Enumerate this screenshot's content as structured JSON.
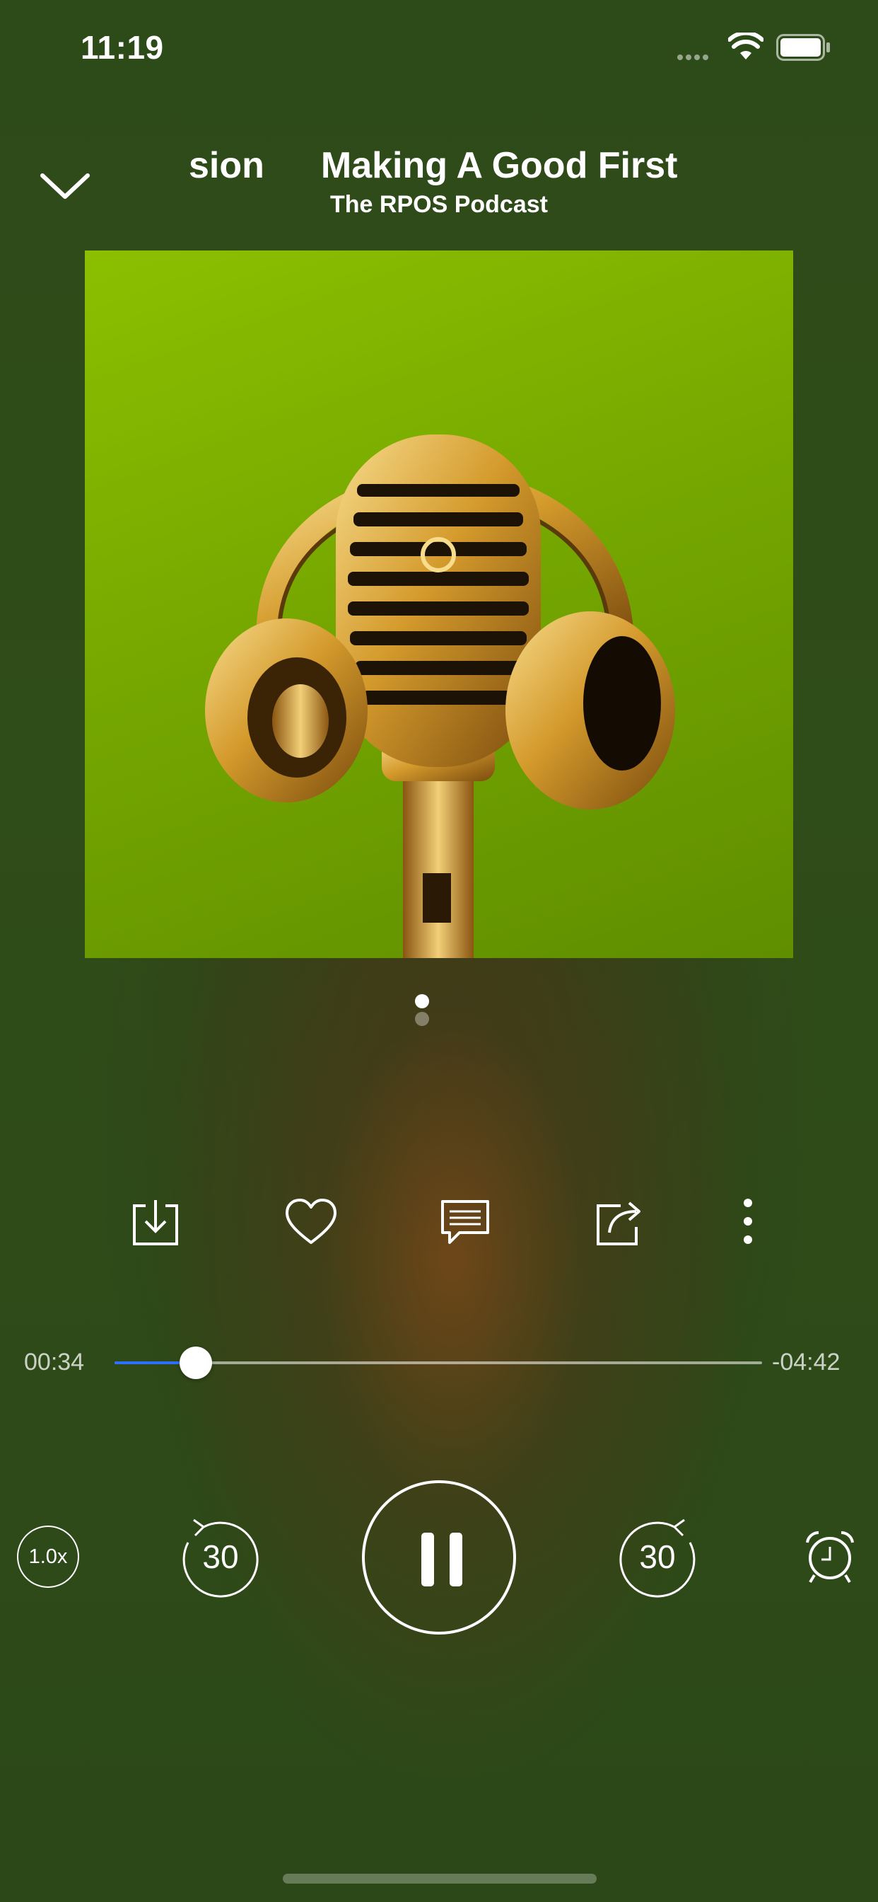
{
  "status_bar": {
    "time": "11:19",
    "icons": [
      "cellular-dots-icon",
      "wifi-icon",
      "battery-icon"
    ]
  },
  "header": {
    "collapse_icon": "chevron-down-icon",
    "title_scroll_previous": "Obsession",
    "title_scroll_current": "Making A Good First",
    "podcast_name": "The RPOS Podcast"
  },
  "artwork": {
    "description_icon": "microphone-headphones-artwork",
    "background_color": "#7cb000"
  },
  "pager": {
    "page_count": 2,
    "active_index": 0
  },
  "actions": [
    {
      "icon": "download-icon"
    },
    {
      "icon": "heart-icon"
    },
    {
      "icon": "comment-icon"
    },
    {
      "icon": "share-icon"
    },
    {
      "icon": "more-vertical-icon"
    }
  ],
  "progress": {
    "elapsed": "00:34",
    "remaining": "-04:42",
    "fraction": 0.126,
    "fill_color": "#2f6fff"
  },
  "transport": {
    "speed_label": "1.0x",
    "skip_back_label": "30",
    "skip_forward_label": "30",
    "play_state_icon": "pause-icon",
    "sleep_timer_icon": "alarm-clock-icon"
  }
}
